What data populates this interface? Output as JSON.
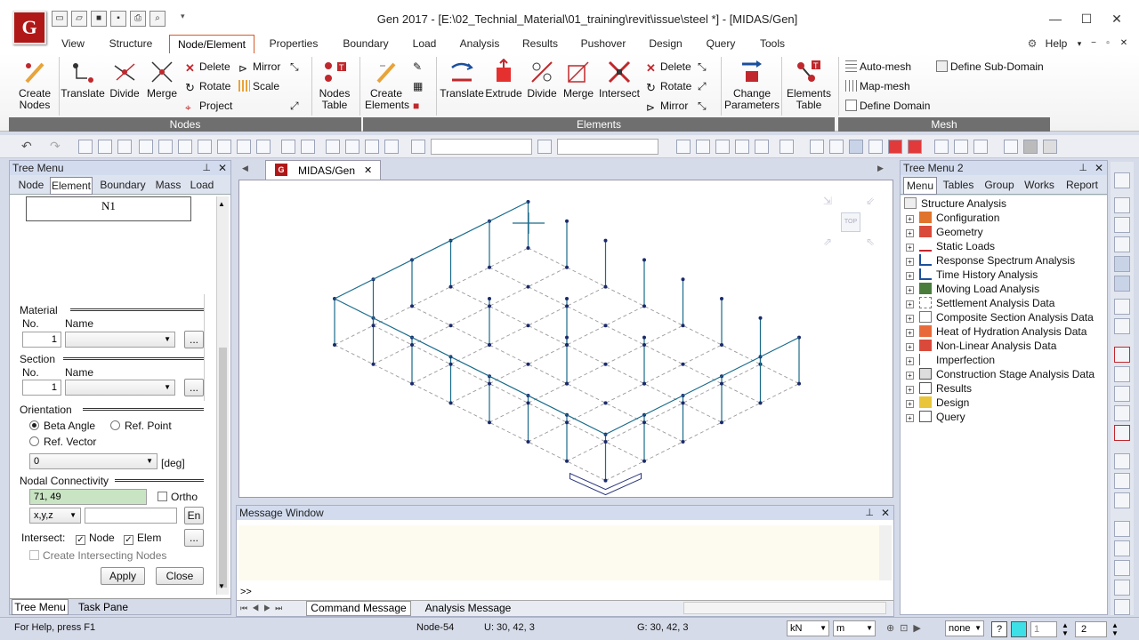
{
  "app": {
    "logo_text": "G",
    "title": "Gen 2017 - [E:\\02_Technial_Material\\01_training\\revit\\issue\\steel *] - [MIDAS/Gen]"
  },
  "menu_tabs": [
    "View",
    "Structure",
    "Node/Element",
    "Properties",
    "Boundary",
    "Load",
    "Analysis",
    "Results",
    "Pushover",
    "Design",
    "Query",
    "Tools"
  ],
  "help_label": "Help",
  "ribbon": {
    "nodes": {
      "create_nodes": "Create Nodes",
      "translate": "Translate",
      "divide": "Divide",
      "merge": "Merge",
      "delete": "Delete",
      "rotate": "Rotate",
      "project": "Project",
      "mirror": "Mirror",
      "scale": "Scale",
      "nodes_table": "Nodes Table",
      "group_label": "Nodes"
    },
    "elements": {
      "create_elements": "Create Elements",
      "translate": "Translate",
      "extrude": "Extrude",
      "divide": "Divide",
      "merge": "Merge",
      "intersect": "Intersect",
      "delete": "Delete",
      "rotate": "Rotate",
      "mirror": "Mirror",
      "change_parameters": "Change Parameters",
      "elements_table": "Elements Table",
      "group_label": "Elements"
    },
    "mesh": {
      "auto_mesh": "Auto-mesh",
      "map_mesh": "Map-mesh",
      "define_domain": "Define Domain",
      "define_sub_domain": "Define Sub-Domain",
      "group_label": "Mesh"
    }
  },
  "tree_menu": {
    "title": "Tree Menu",
    "tabs": [
      "Node",
      "Element",
      "Boundary",
      "Mass",
      "Load"
    ],
    "preview_label": "N1",
    "material": {
      "section": "Material",
      "no_label": "No.",
      "name_label": "Name",
      "no_value": "1",
      "browse": "..."
    },
    "section": {
      "section": "Section",
      "no_label": "No.",
      "name_label": "Name",
      "no_value": "1",
      "browse": "..."
    },
    "orientation": {
      "section": "Orientation",
      "beta_angle": "Beta Angle",
      "ref_point": "Ref. Point",
      "ref_vector": "Ref. Vector",
      "angle_value": "0",
      "unit": "[deg]"
    },
    "nodal": {
      "section": "Nodal Connectivity",
      "value": "71, 49",
      "ortho": "Ortho",
      "coord": "x,y,z",
      "en": "En"
    },
    "intersect": {
      "label": "Intersect:",
      "node": "Node",
      "elem": "Elem",
      "more": "...",
      "create_nodes": "Create Intersecting Nodes"
    },
    "apply": "Apply",
    "close": "Close",
    "bottom_tabs": [
      "Tree Menu",
      "Task Pane"
    ]
  },
  "view": {
    "tab_label": "MIDAS/Gen",
    "cube_label": "TOP"
  },
  "message_window": {
    "title": "Message Window",
    "prompt": ">>",
    "tabs": [
      "Command Message",
      "Analysis Message"
    ]
  },
  "tree_menu2": {
    "title": "Tree Menu 2",
    "tabs": [
      "Menu",
      "Tables",
      "Group",
      "Works",
      "Report"
    ],
    "root": "Structure Analysis",
    "items": [
      "Configuration",
      "Geometry",
      "Static Loads",
      "Response Spectrum Analysis",
      "Time History Analysis",
      "Moving Load Analysis",
      "Settlement Analysis Data",
      "Composite Section Analysis Data",
      "Heat of Hydration Analysis Data",
      "Non-Linear Analysis Data",
      "Imperfection",
      "Construction Stage Analysis Data",
      "Results",
      "Design",
      "Query"
    ]
  },
  "status": {
    "help": "For Help, press F1",
    "node": "Node-54",
    "u": "U: 30, 42, 3",
    "g": "G: 30, 42, 3",
    "force_unit": "kN",
    "length_unit": "m",
    "none_label": "none",
    "page": "1",
    "page2": "2"
  },
  "colors": {
    "accent": "#d75a2a",
    "group_bar": "#6f6f6f",
    "model_line": "#1a6b8a",
    "node": "#1a2a6c"
  }
}
